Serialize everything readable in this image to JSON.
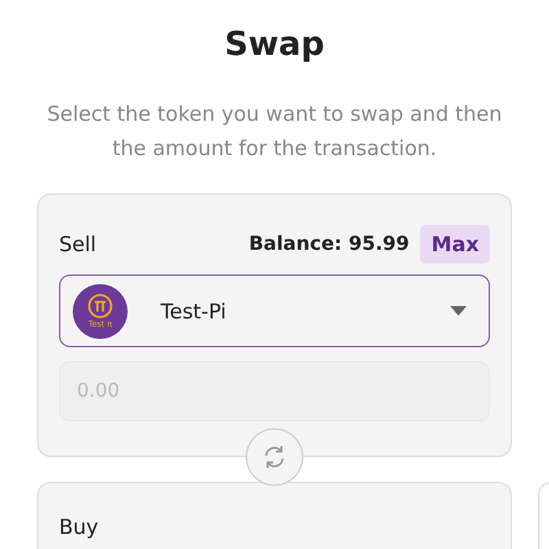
{
  "title": "Swap",
  "subtitle": "Select the token you want to swap and then the amount for the transaction.",
  "sell": {
    "label": "Sell",
    "balance": "Balance: 95.99",
    "max_button": "Max",
    "token": {
      "name": "Test-Pi",
      "logo_caption": "Test π"
    },
    "amount": {
      "placeholder": "0.00"
    }
  },
  "buy": {
    "label": "Buy"
  }
}
